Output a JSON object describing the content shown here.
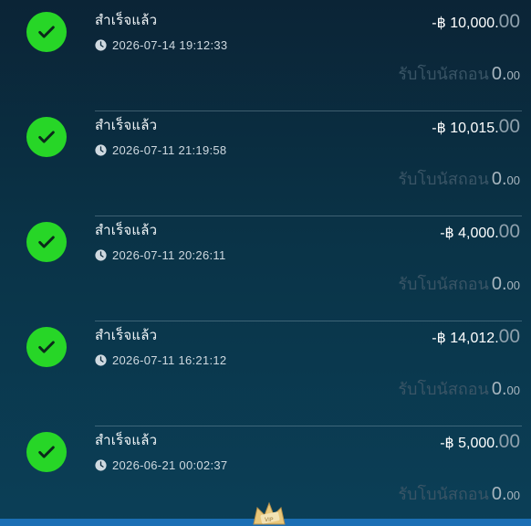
{
  "transactions": [
    {
      "status": "สำเร็จแล้ว",
      "timestamp": "2026-07-14 19:12:33",
      "amount": "-฿ 10,000.",
      "amount_decimals": "00",
      "bonus_label": "รับโบนัสถอน",
      "bonus_int": "0.",
      "bonus_dec": "00"
    },
    {
      "status": "สำเร็จแล้ว",
      "timestamp": "2026-07-11 21:19:58",
      "amount": "-฿ 10,015.",
      "amount_decimals": "00",
      "bonus_label": "รับโบนัสถอน",
      "bonus_int": "0.",
      "bonus_dec": "00"
    },
    {
      "status": "สำเร็จแล้ว",
      "timestamp": "2026-07-11 20:26:11",
      "amount": "-฿ 4,000.",
      "amount_decimals": "00",
      "bonus_label": "รับโบนัสถอน",
      "bonus_int": "0.",
      "bonus_dec": "00"
    },
    {
      "status": "สำเร็จแล้ว",
      "timestamp": "2026-07-11 16:21:12",
      "amount": "-฿ 14,012.",
      "amount_decimals": "00",
      "bonus_label": "รับโบนัสถอน",
      "bonus_int": "0.",
      "bonus_dec": "00"
    },
    {
      "status": "สำเร็จแล้ว",
      "timestamp": "2026-06-21 00:02:37",
      "amount": "-฿ 5,000.",
      "amount_decimals": "00",
      "bonus_label": "รับโบนัสถอน",
      "bonus_int": "0.",
      "bonus_dec": "00"
    }
  ],
  "icons": {
    "status": "check-circle-icon",
    "time": "clock-icon",
    "footer": "vip-icon"
  },
  "colors": {
    "success": "#27d627",
    "footer_accent": "#1b6fb5"
  },
  "footer": {
    "vip_text": "VIP"
  }
}
